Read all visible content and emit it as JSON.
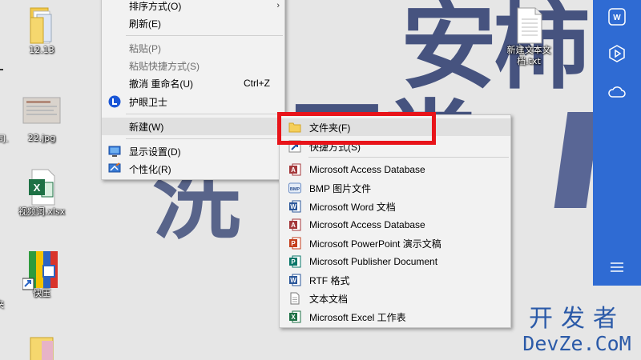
{
  "desktop": {
    "icons": [
      {
        "label": "12.13"
      },
      {
        "label": "22.jpg"
      },
      {
        "label": "视频词.xlsx"
      },
      {
        "label": "快压"
      },
      {
        "label": "新建文本文\n档.txt"
      }
    ],
    "edge_labels": [
      "司.",
      "司.",
      "夹"
    ]
  },
  "context_menu": {
    "items": [
      {
        "label": "排序方式(O)"
      },
      {
        "label": "刷新(E)"
      },
      {
        "label": "粘贴(P)"
      },
      {
        "label": "粘贴快捷方式(S)"
      },
      {
        "label": "撤消 重命名(U)",
        "shortcut": "Ctrl+Z"
      },
      {
        "label": "护眼卫士"
      },
      {
        "label": "新建(W)"
      },
      {
        "label": "显示设置(D)"
      },
      {
        "label": "个性化(R)"
      }
    ]
  },
  "new_submenu": {
    "items": [
      {
        "label": "文件夹(F)",
        "icon": "folder-icon"
      },
      {
        "label": "快捷方式(S)",
        "icon": "shortcut-icon"
      },
      {
        "label": "Microsoft Access Database",
        "icon": "access-icon"
      },
      {
        "label": "BMP 图片文件",
        "icon": "bmp-icon"
      },
      {
        "label": "Microsoft Word 文档",
        "icon": "word-icon"
      },
      {
        "label": "Microsoft Access Database",
        "icon": "access-icon"
      },
      {
        "label": "Microsoft PowerPoint 演示文稿",
        "icon": "powerpoint-icon"
      },
      {
        "label": "Microsoft Publisher Document",
        "icon": "publisher-icon"
      },
      {
        "label": "RTF 格式",
        "icon": "rtf-icon"
      },
      {
        "label": "文本文档",
        "icon": "text-doc-icon"
      },
      {
        "label": "Microsoft Excel 工作表",
        "icon": "excel-icon"
      }
    ]
  },
  "watermark": {
    "cn": "开发者",
    "en": "DevZe.CoM"
  },
  "colors": {
    "highlight_box": "#e8141a",
    "wps_sidebar": "#2f6bd3"
  }
}
